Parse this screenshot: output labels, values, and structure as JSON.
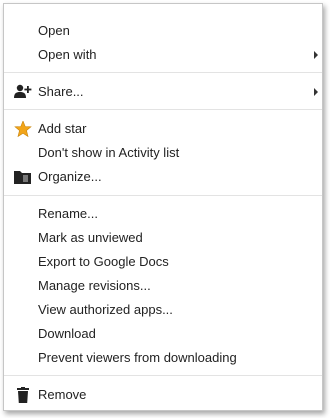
{
  "menu": {
    "open": "Open",
    "open_with": "Open with",
    "share": "Share...",
    "add_star": "Add star",
    "dont_show": "Don't show in Activity list",
    "organize": "Organize...",
    "rename": "Rename...",
    "mark_unviewed": "Mark as unviewed",
    "export_docs": "Export to Google Docs",
    "manage_revisions": "Manage revisions...",
    "view_apps": "View authorized apps...",
    "download": "Download",
    "prevent_download": "Prevent viewers from downloading",
    "remove": "Remove"
  },
  "icons": {
    "share": "add-person-icon",
    "star": "star-icon",
    "organize": "folder-icon",
    "remove": "trash-icon"
  },
  "colors": {
    "star": "#f2a51a",
    "icon_dark": "#222222",
    "separator": "#e3e3e3"
  }
}
